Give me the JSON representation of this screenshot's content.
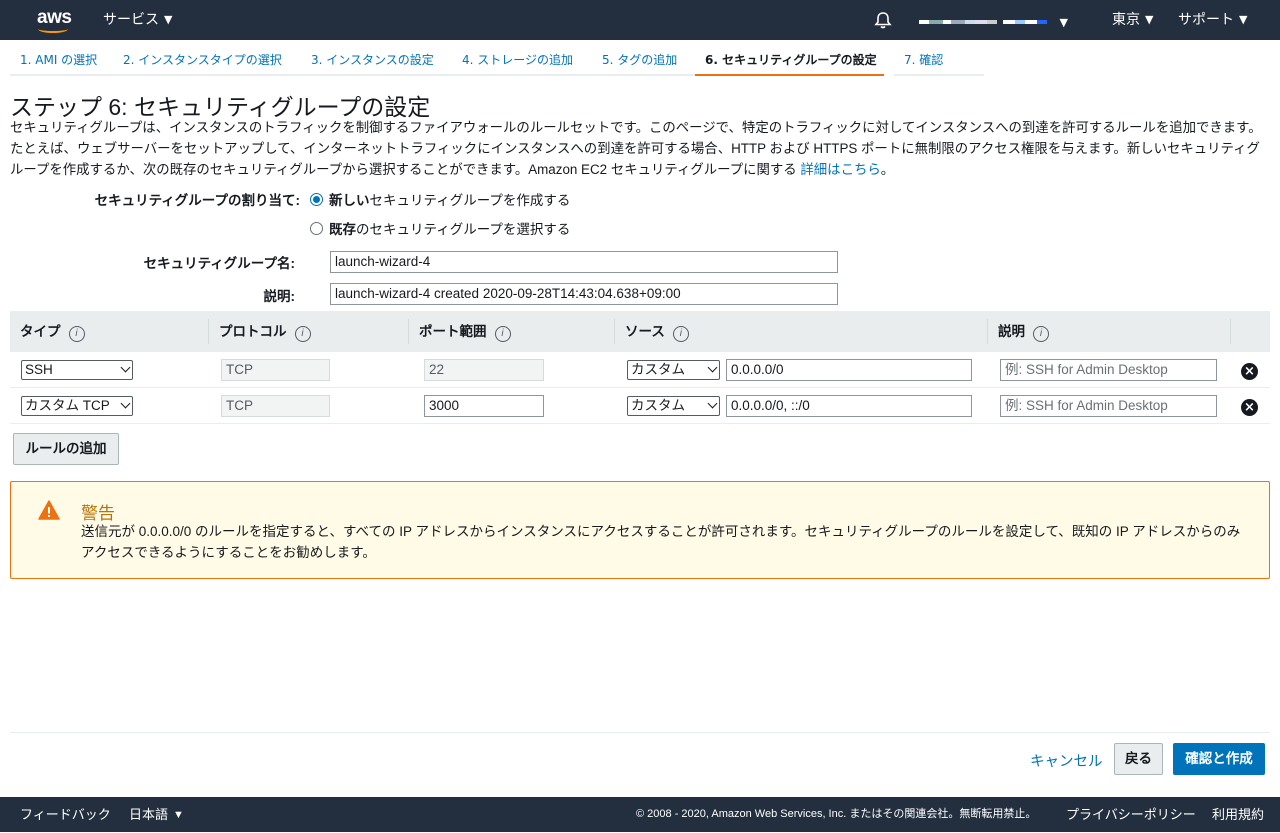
{
  "topnav": {
    "logo_text": "aws",
    "services": "サービス",
    "region": "東京",
    "support": "サポート"
  },
  "tabs": [
    "1. AMI の選択",
    "2. インスタンスタイプの選択",
    "3. インスタンスの設定",
    "4. ストレージの追加",
    "5. タグの追加",
    "6. セキュリティグループの設定",
    "7. 確認"
  ],
  "page": {
    "title": "ステップ 6: セキュリティグループの設定",
    "description": "セキュリティグループは、インスタンスのトラフィックを制御するファイアウォールのルールセットです。このページで、特定のトラフィックに対してインスタンスへの到達を許可するルールを追加できます。たとえば、ウェブサーバーをセットアップして、インターネットトラフィックにインスタンスへの到達を許可する場合、HTTP および HTTPS ポートに無制限のアクセス権限を与えます。新しいセキュリティグループを作成するか、次の既存のセキュリティグループから選択することができます。Amazon EC2 セキュリティグループに関する ",
    "details_link": "詳細はこちら",
    "description_end": "。"
  },
  "assign": {
    "label": "セキュリティグループの割り当て:",
    "option_new_bold": "新しい",
    "option_new_rest": "セキュリティグループを作成する",
    "option_existing_bold": "既存",
    "option_existing_rest": "のセキュリティグループを選択する",
    "selected": "new"
  },
  "group_name": {
    "label": "セキュリティグループ名:",
    "value": "launch-wizard-4"
  },
  "group_desc": {
    "label": "説明:",
    "value": "launch-wizard-4 created 2020-09-28T14:43:04.638+09:00"
  },
  "rules_table": {
    "headers": [
      "タイプ",
      "プロトコル",
      "ポート範囲",
      "ソース",
      "説明"
    ],
    "info_icon": "i",
    "rows": [
      {
        "type": "SSH",
        "protocol": "TCP",
        "port": "22",
        "source_mode": "カスタム",
        "source": "0.0.0.0/0",
        "description_placeholder": "例: SSH for Admin Desktop"
      },
      {
        "type": "カスタム TCP",
        "protocol": "TCP",
        "port": "3000",
        "source_mode": "カスタム",
        "source": "0.0.0.0/0, ::/0",
        "description_placeholder": "例: SSH for Admin Desktop"
      }
    ]
  },
  "add_rule_button": "ルールの追加",
  "warning": {
    "title": "警告",
    "text": "送信元が 0.0.0.0/0 のルールを指定すると、すべての IP アドレスからインスタンスにアクセスすることが許可されます。セキュリティグループのルールを設定して、既知の IP アドレスからのみアクセスできるようにすることをお勧めします。"
  },
  "actions": {
    "cancel": "キャンセル",
    "back": "戻る",
    "review": "確認と作成"
  },
  "footer": {
    "feedback": "フィードバック",
    "language": "日本語",
    "copyright": "© 2008 - 2020, Amazon Web Services, Inc. またはその関連会社。無断転用禁止。",
    "privacy": "プライバシーポリシー",
    "terms": "利用規約"
  },
  "colors": {
    "nav_bg": "#232f3e",
    "link": "#0073bb",
    "active_tab": "#ec7211",
    "primary_button": "#0073bb",
    "warning_bg": "#fffbe6",
    "warning_border": "#ec7211"
  }
}
